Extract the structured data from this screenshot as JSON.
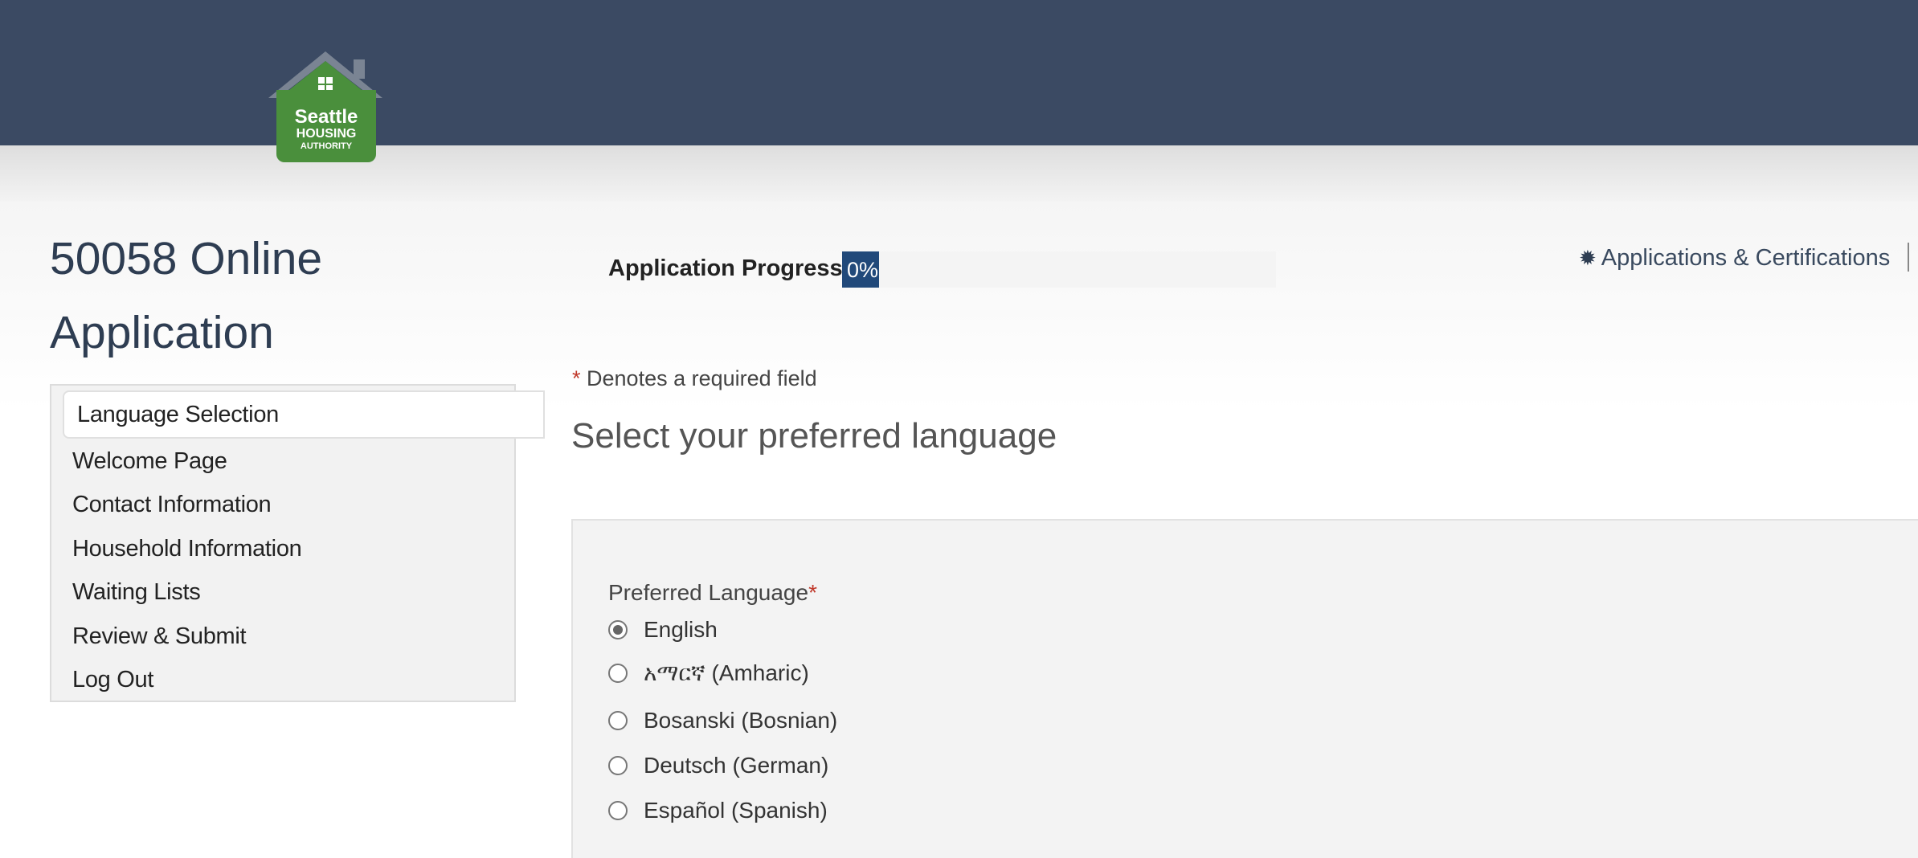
{
  "header": {
    "logo": {
      "line1": "Seattle",
      "line2": "HOUSING",
      "line3": "AUTHORITY"
    }
  },
  "page_title": "50058 Online Application",
  "sidebar": {
    "items": [
      {
        "label": "Language Selection",
        "active": true
      },
      {
        "label": "Welcome Page"
      },
      {
        "label": "Contact Information"
      },
      {
        "label": "Household Information"
      },
      {
        "label": "Waiting Lists"
      },
      {
        "label": "Review & Submit"
      },
      {
        "label": "Log Out"
      }
    ]
  },
  "progress": {
    "label": "Application Progress",
    "value_text": "0%",
    "value": 0
  },
  "top_link": {
    "icon": "gear-icon",
    "label": "Applications & Certifications"
  },
  "required_note": {
    "star": "*",
    "text": " Denotes a required field"
  },
  "section_title": "Select your preferred language",
  "form": {
    "preferred_language_label": "Preferred Language",
    "required_star": "*",
    "options": [
      {
        "label": "English",
        "checked": true
      },
      {
        "label": "አማርኛ (Amharic)",
        "checked": false
      },
      {
        "label": "Bosanski (Bosnian)",
        "checked": false
      },
      {
        "label": "Deutsch (German)",
        "checked": false
      },
      {
        "label": "Español (Spanish)",
        "checked": false
      }
    ]
  },
  "colors": {
    "header_bg": "#3b4a63",
    "logo_green": "#4a8f3c",
    "progress_fill": "#21497a",
    "required_red": "#c0392b"
  }
}
